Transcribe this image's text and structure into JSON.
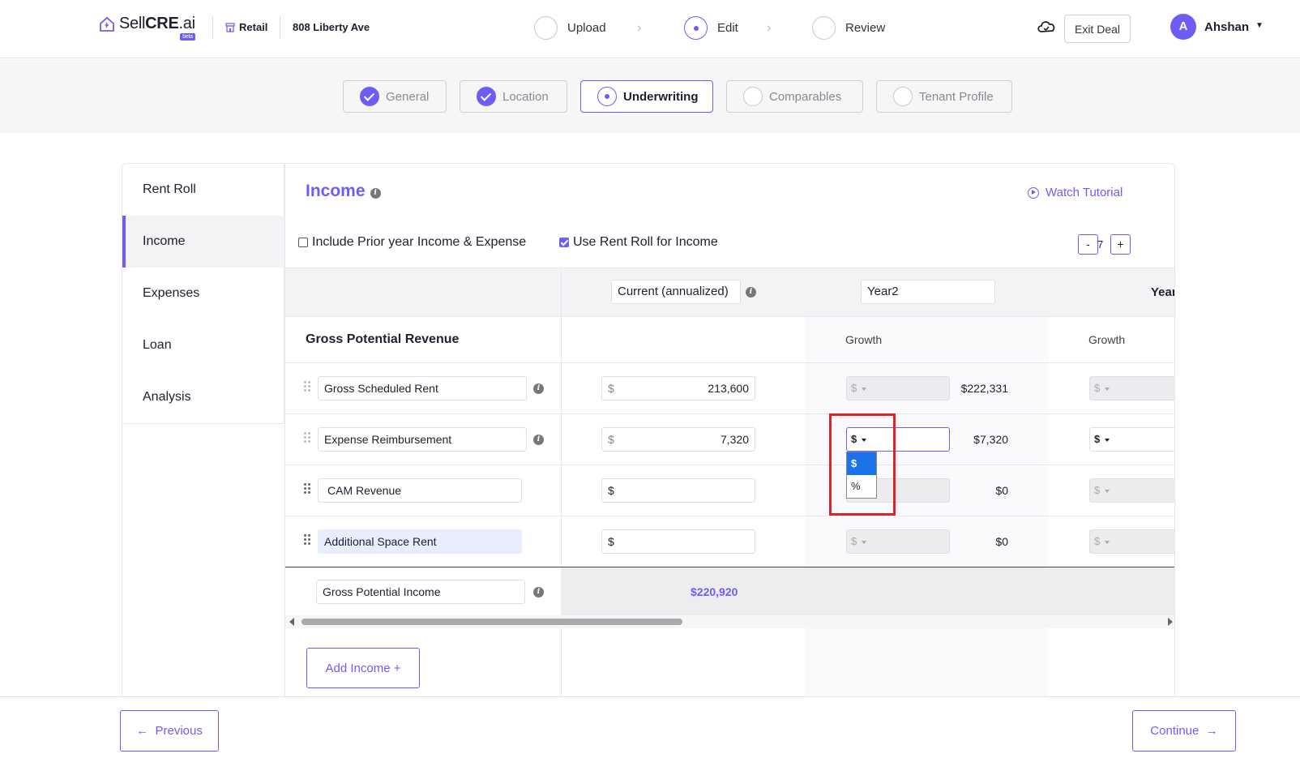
{
  "header": {
    "logo_text_a": "Sell",
    "logo_text_b": "CRE",
    "logo_text_c": ".ai",
    "beta": "beta",
    "property_type": "Retail",
    "address": "808 Liberty Ave",
    "steps": [
      "Upload",
      "Edit",
      "Review"
    ],
    "exit_label": "Exit Deal",
    "avatar_initial": "A",
    "user_name": "Ahshan"
  },
  "subtabs": [
    "General",
    "Location",
    "Underwriting",
    "Comparables",
    "Tenant Profile"
  ],
  "sidenav": [
    "Rent Roll",
    "Income",
    "Expenses",
    "Loan",
    "Analysis"
  ],
  "main": {
    "title": "Income",
    "tutorial": "Watch Tutorial",
    "include_prior": "Include Prior year Income & Expense",
    "use_rent_roll": "Use Rent Roll for Income",
    "years_minus": "-",
    "years_count": "7",
    "years_plus": "+"
  },
  "table": {
    "col_current": "Current (annualized)",
    "col_year2": "Year2",
    "col_year3": "Year",
    "section": "Gross Potential Revenue",
    "growth": "Growth",
    "currency": "$",
    "rows": [
      {
        "label": "Gross Scheduled Rent",
        "current": "213,600",
        "year2": "$222,331"
      },
      {
        "label": "Expense Reimbursement",
        "current": "7,320",
        "year2": "$7,320"
      },
      {
        "label": "CAM Revenue",
        "current": "",
        "year2": "$0"
      },
      {
        "label": "Additional Space Rent",
        "current": "",
        "year2": "$0"
      }
    ],
    "total_label": "Gross Potential Income",
    "total_value": "$220,920",
    "dropdown_options": [
      "$",
      "%"
    ]
  },
  "buttons": {
    "add_income": "Add Income +",
    "previous": "Previous",
    "continue": "Continue"
  },
  "colors": {
    "accent": "#6e5df5",
    "highlight": "#e02424"
  }
}
